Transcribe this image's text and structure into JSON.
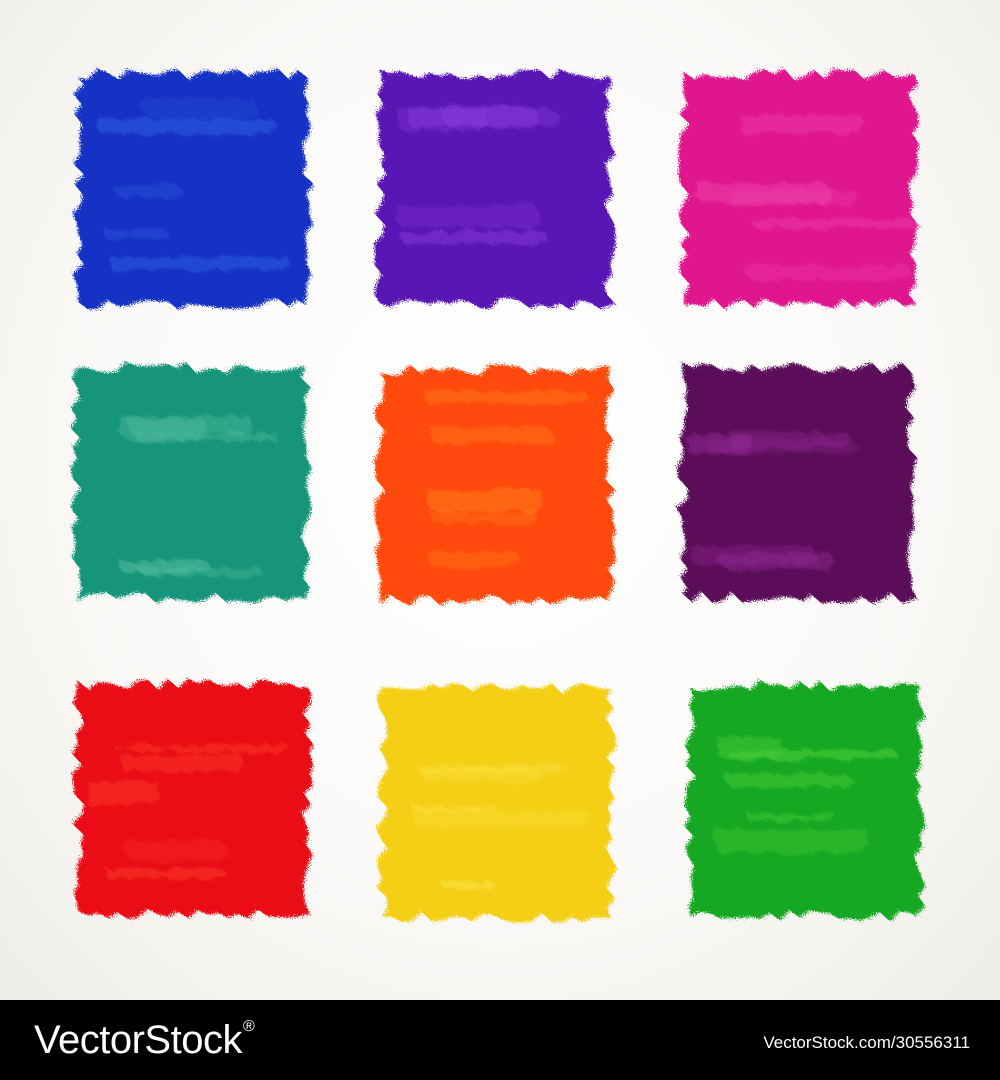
{
  "footer": {
    "brand": "VectorStock",
    "registered": "®",
    "reference": "VectorStock.com/30556311"
  },
  "swatches": [
    {
      "name": "blue",
      "color": "#1433c4",
      "highlight": "#2f5ee6"
    },
    {
      "name": "violet",
      "color": "#5a12b4",
      "highlight": "#8a3ee0"
    },
    {
      "name": "magenta",
      "color": "#e0168f",
      "highlight": "#f24bb0"
    },
    {
      "name": "teal",
      "color": "#13957a",
      "highlight": "#5cc2a6"
    },
    {
      "name": "orange",
      "color": "#ff4a08",
      "highlight": "#ff8a1e"
    },
    {
      "name": "plum",
      "color": "#5c0f5a",
      "highlight": "#9a2e9e"
    },
    {
      "name": "red",
      "color": "#ea0f12",
      "highlight": "#ff3a2a"
    },
    {
      "name": "yellow",
      "color": "#f4cf12",
      "highlight": "#ffe54a"
    },
    {
      "name": "green",
      "color": "#14a824",
      "highlight": "#4fd13e"
    }
  ]
}
